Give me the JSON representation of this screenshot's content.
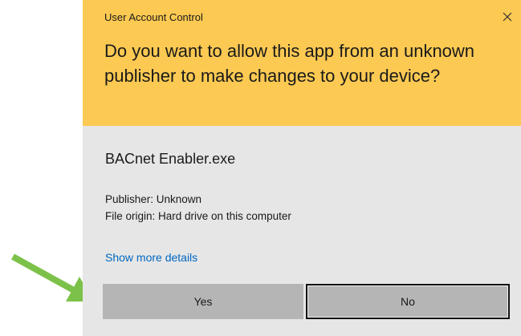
{
  "dialog": {
    "window_title": "User Account Control",
    "question": "Do you want to allow this app from an unknown publisher to make changes to your device?",
    "app_name": "BACnet Enabler.exe",
    "publisher": "Publisher: Unknown",
    "file_origin": "File origin: Hard drive on this computer",
    "more_details_link": "Show more details",
    "yes_label": "Yes",
    "no_label": "No",
    "close_icon": "close-icon"
  },
  "colors": {
    "header_bg": "#fcc952",
    "body_bg": "#e6e6e6",
    "button_bg": "#b5b5b5",
    "link": "#0067c0",
    "arrow": "#7cc24a"
  }
}
